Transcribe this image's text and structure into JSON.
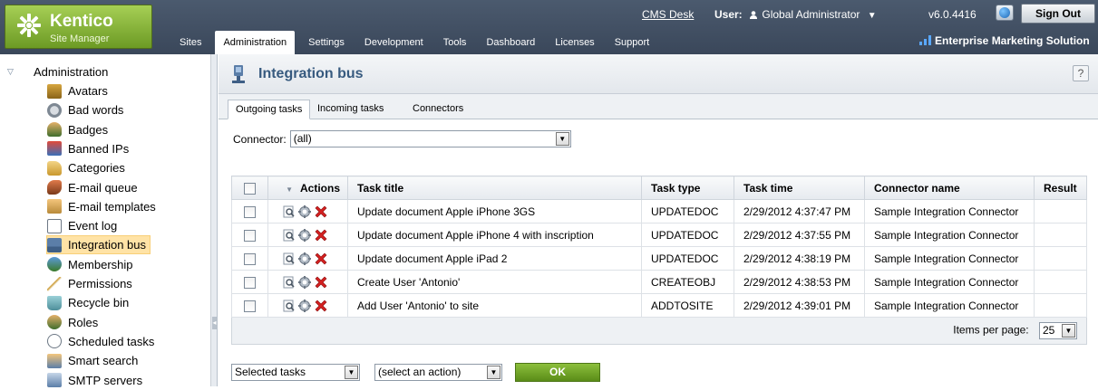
{
  "brand": {
    "name": "Kentico",
    "subtitle": "Site Manager"
  },
  "header": {
    "cms_desk": "CMS Desk",
    "user_label": "User:",
    "user_name": "Global Administrator",
    "version": "v6.0.4416",
    "sign_out": "Sign Out",
    "edition": "Enterprise Marketing Solution"
  },
  "main_menu": [
    "Sites",
    "Administration",
    "Settings",
    "Development",
    "Tools",
    "Dashboard",
    "Licenses",
    "Support"
  ],
  "active_menu": "Administration",
  "tree": {
    "root": "Administration",
    "items": [
      {
        "label": "Avatars",
        "icon": "avatars-icon"
      },
      {
        "label": "Bad words",
        "icon": "bad-words-icon"
      },
      {
        "label": "Badges",
        "icon": "badges-icon"
      },
      {
        "label": "Banned IPs",
        "icon": "banned-ips-icon"
      },
      {
        "label": "Categories",
        "icon": "categories-icon"
      },
      {
        "label": "E-mail queue",
        "icon": "email-queue-icon"
      },
      {
        "label": "E-mail templates",
        "icon": "email-templates-icon"
      },
      {
        "label": "Event log",
        "icon": "event-log-icon"
      },
      {
        "label": "Integration bus",
        "icon": "integration-bus-icon",
        "selected": true
      },
      {
        "label": "Membership",
        "icon": "membership-icon"
      },
      {
        "label": "Permissions",
        "icon": "permissions-icon"
      },
      {
        "label": "Recycle bin",
        "icon": "recycle-bin-icon"
      },
      {
        "label": "Roles",
        "icon": "roles-icon"
      },
      {
        "label": "Scheduled tasks",
        "icon": "scheduled-tasks-icon"
      },
      {
        "label": "Smart search",
        "icon": "smart-search-icon"
      },
      {
        "label": "SMTP servers",
        "icon": "smtp-servers-icon"
      }
    ]
  },
  "page": {
    "title": "Integration bus",
    "help": "?",
    "tabs": [
      "Outgoing tasks",
      "Incoming tasks",
      "Connectors"
    ],
    "active_tab": "Outgoing tasks",
    "connector_label": "Connector:",
    "connector_value": "(all)"
  },
  "grid": {
    "columns": [
      "Actions",
      "Task title",
      "Task type",
      "Task time",
      "Connector name",
      "Result"
    ],
    "rows": [
      {
        "title": "Update document Apple iPhone 3GS",
        "type": "UPDATEDOC",
        "time": "2/29/2012 4:37:47 PM",
        "connector": "Sample Integration Connector",
        "result": ""
      },
      {
        "title": "Update document Apple iPhone 4 with inscription",
        "type": "UPDATEDOC",
        "time": "2/29/2012 4:37:55 PM",
        "connector": "Sample Integration Connector",
        "result": ""
      },
      {
        "title": "Update document Apple iPad 2",
        "type": "UPDATEDOC",
        "time": "2/29/2012 4:38:19 PM",
        "connector": "Sample Integration Connector",
        "result": ""
      },
      {
        "title": "Create User 'Antonio'",
        "type": "CREATEOBJ",
        "time": "2/29/2012 4:38:53 PM",
        "connector": "Sample Integration Connector",
        "result": ""
      },
      {
        "title": "Add User 'Antonio' to site",
        "type": "ADDTOSITE",
        "time": "2/29/2012 4:39:01 PM",
        "connector": "Sample Integration Connector",
        "result": ""
      }
    ],
    "items_per_page_label": "Items per page:",
    "items_per_page": "25"
  },
  "bottom": {
    "scope_value": "Selected tasks",
    "action_value": "(select an action)",
    "ok": "OK"
  }
}
